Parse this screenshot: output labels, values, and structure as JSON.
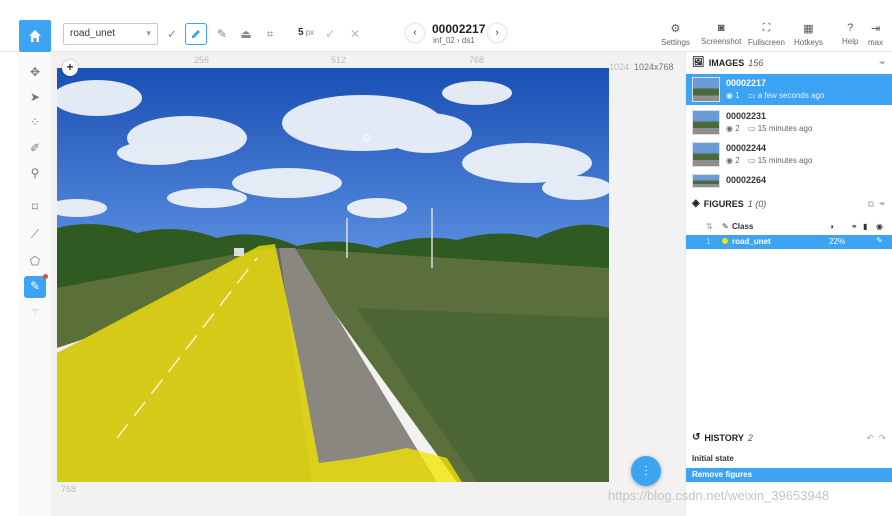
{
  "toolbar": {
    "model": "road_unet",
    "brush_size": "5",
    "brush_unit": "px"
  },
  "image_nav": {
    "title": "00002217",
    "subtitle": "inf_02 › ds1"
  },
  "top_actions": [
    {
      "label": "Settings",
      "icon": "gear-icon"
    },
    {
      "label": "Screenshot",
      "icon": "camera-icon"
    },
    {
      "label": "Fullscreen",
      "icon": "fullscreen-icon"
    },
    {
      "label": "Hotkeys",
      "icon": "keyboard-icon"
    },
    {
      "label": "Help",
      "icon": "help-icon"
    },
    {
      "label": "max",
      "icon": "logout-icon"
    }
  ],
  "canvas": {
    "ruler_labels": [
      "256",
      "512",
      "768",
      "1024"
    ],
    "ruler_bottom": "768",
    "size": "1024x768"
  },
  "images_panel": {
    "title": "IMAGES",
    "count": "156",
    "items": [
      {
        "name": "00002217",
        "figures": "1",
        "time": "a few seconds ago"
      },
      {
        "name": "00002231",
        "figures": "2",
        "time": "15 minutes ago"
      },
      {
        "name": "00002244",
        "figures": "2",
        "time": "15 minutes ago"
      },
      {
        "name": "00002264",
        "figures": "",
        "time": ""
      }
    ]
  },
  "figures_panel": {
    "title": "FIGURES",
    "count": "1 (0)",
    "column_class": "Class",
    "rows": [
      {
        "id": "1",
        "class": "road_unet",
        "area": "22%",
        "color": "#f2e600"
      }
    ]
  },
  "history_panel": {
    "title": "HISTORY",
    "count": "2",
    "items": [
      "Initial state",
      "Remove figures"
    ]
  },
  "watermark": "https://blog.csdn.net/weixin_39653948",
  "colors": {
    "accent": "#3da4f4",
    "mask": "#f2e600"
  }
}
